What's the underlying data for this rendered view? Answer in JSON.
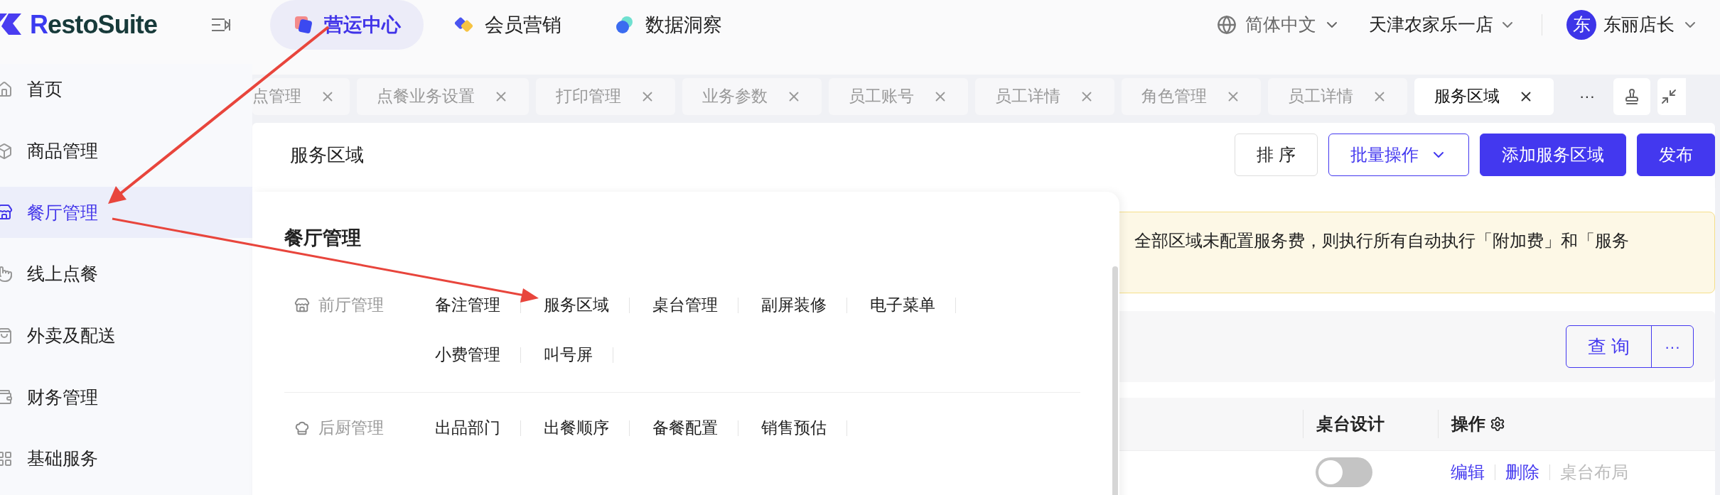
{
  "logo": "RestoSuite",
  "top_nav": [
    {
      "label": "营运中心",
      "selected": true
    },
    {
      "label": "会员营销",
      "selected": false
    },
    {
      "label": "数据洞察",
      "selected": false
    }
  ],
  "language": "简体中文",
  "store": "天津农家乐一店",
  "user": {
    "avatar": "东",
    "name": "东丽店长"
  },
  "sidebar": [
    {
      "label": "首页",
      "selected": false
    },
    {
      "label": "商品管理",
      "selected": false
    },
    {
      "label": "餐厅管理",
      "selected": true
    },
    {
      "label": "线上点餐",
      "selected": false
    },
    {
      "label": "外卖及配送",
      "selected": false
    },
    {
      "label": "财务管理",
      "selected": false
    },
    {
      "label": "基础服务",
      "selected": false
    }
  ],
  "tabs": [
    {
      "label": "点管理",
      "selected": false
    },
    {
      "label": "点餐业务设置",
      "selected": false
    },
    {
      "label": "打印管理",
      "selected": false
    },
    {
      "label": "业务参数",
      "selected": false
    },
    {
      "label": "员工账号",
      "selected": false
    },
    {
      "label": "员工详情",
      "selected": false
    },
    {
      "label": "角色管理",
      "selected": false
    },
    {
      "label": "员工详情",
      "selected": false
    },
    {
      "label": "服务区域",
      "selected": true
    }
  ],
  "tabs_more": "···",
  "page_title": "服务区域",
  "header_buttons": [
    {
      "label": "排 序",
      "kind": "default"
    },
    {
      "label": "批量操作",
      "kind": "outline"
    },
    {
      "label": "添加服务区域",
      "kind": "primary"
    },
    {
      "label": "发布",
      "kind": "primary"
    }
  ],
  "notice": "全部区域未配置服务费，则执行所有自动执行「附加费」和「服务",
  "filter": {
    "query_button": "查 询",
    "more_button": "···"
  },
  "table": {
    "columns": [
      "桌台设计",
      "操作"
    ],
    "rows": [
      {
        "toggle_on": false,
        "actions": [
          {
            "label": "编辑",
            "disabled": false
          },
          {
            "label": "删除",
            "disabled": false
          },
          {
            "label": "桌台布局",
            "disabled": true
          }
        ]
      }
    ]
  },
  "menu_popup": {
    "title": "餐厅管理",
    "groups": [
      {
        "kind": "front",
        "label": "前厅管理",
        "items": [
          "备注管理",
          "服务区域",
          "桌台管理",
          "副屏装修",
          "电子菜单",
          "小费管理",
          "叫号屏"
        ]
      },
      {
        "kind": "kitchen",
        "label": "后厨管理",
        "items": [
          "出品部门",
          "出餐顺序",
          "备餐配置",
          "销售预估"
        ]
      }
    ]
  }
}
